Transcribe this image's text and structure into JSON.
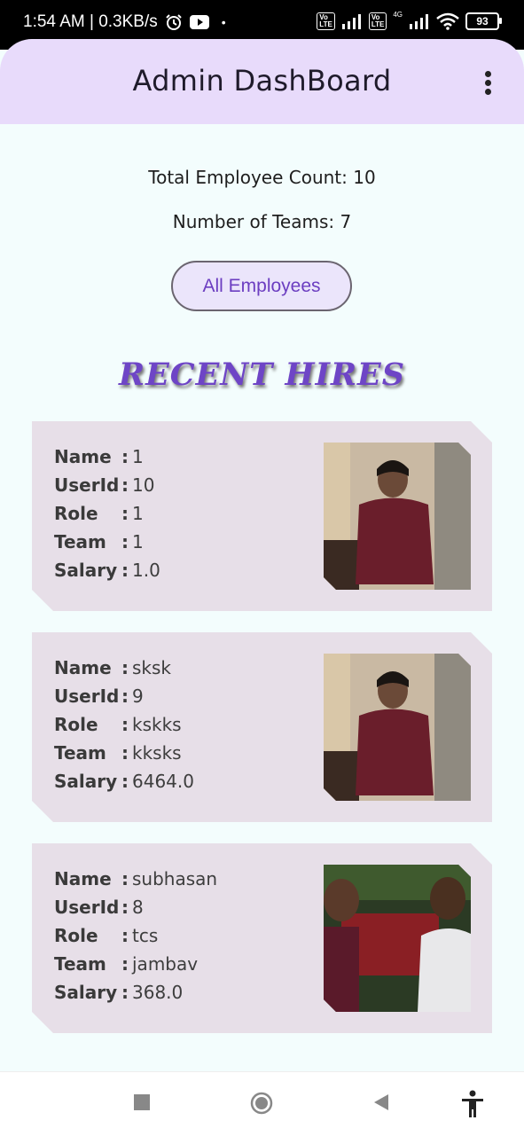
{
  "status": {
    "time": "1:54 AM | 0.3KB/s",
    "battery": "93",
    "volte": "Vo LTE",
    "network": "4G"
  },
  "app": {
    "title": "Admin DashBoard"
  },
  "stats": {
    "total_employees": "Total Employee Count: 10",
    "teams": "Number of Teams: 7"
  },
  "buttons": {
    "all_employees": "All Employees"
  },
  "section_title": "RECENT HIRES",
  "labels": {
    "name": "Name",
    "userid": "UserId",
    "role": "Role",
    "team": "Team",
    "salary": "Salary",
    "sep": ":"
  },
  "employees": [
    {
      "name": "1",
      "userid": "10",
      "role": "1",
      "team": "1",
      "salary": "1.0"
    },
    {
      "name": "sksk",
      "userid": "9",
      "role": "kskks",
      "team": "kksks",
      "salary": "6464.0"
    },
    {
      "name": "subhasan",
      "userid": "8",
      "role": "tcs",
      "team": "jambav",
      "salary": "368.0"
    }
  ],
  "icons": [
    "alarm-icon",
    "youtube-icon",
    "signal-icon",
    "wifi-icon",
    "battery-icon",
    "overflow-menu-icon",
    "recents-icon",
    "home-icon",
    "back-icon",
    "accessibility-icon"
  ]
}
